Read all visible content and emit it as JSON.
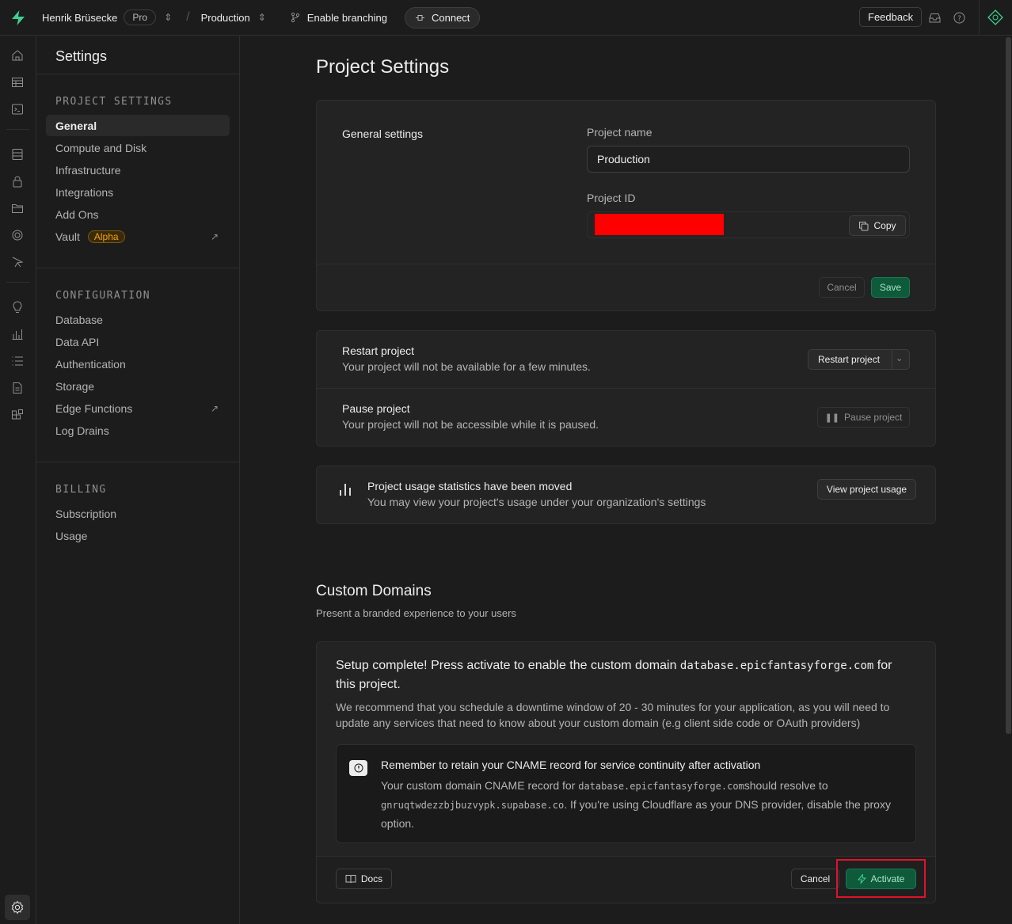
{
  "topbar": {
    "user": "Henrik Brüsecke",
    "plan": "Pro",
    "project": "Production",
    "branching": "Enable branching",
    "connect": "Connect",
    "feedback": "Feedback"
  },
  "menu": {
    "title": "Settings",
    "sections": [
      {
        "title": "PROJECT SETTINGS",
        "items": [
          "General",
          "Compute and Disk",
          "Infrastructure",
          "Integrations",
          "Add Ons",
          "Vault"
        ]
      },
      {
        "title": "CONFIGURATION",
        "items": [
          "Database",
          "Data API",
          "Authentication",
          "Storage",
          "Edge Functions",
          "Log Drains"
        ]
      },
      {
        "title": "BILLING",
        "items": [
          "Subscription",
          "Usage"
        ]
      }
    ],
    "vault_badge": "Alpha"
  },
  "page": {
    "title": "Project Settings",
    "general": {
      "heading": "General settings",
      "name_label": "Project name",
      "name_value": "Production",
      "id_label": "Project ID",
      "copy": "Copy",
      "cancel": "Cancel",
      "save": "Save"
    },
    "restart": {
      "title": "Restart project",
      "desc": "Your project will not be available for a few minutes.",
      "button": "Restart project"
    },
    "pause": {
      "title": "Pause project",
      "desc": "Your project will not be accessible while it is paused.",
      "button": "Pause project"
    },
    "usage": {
      "title": "Project usage statistics have been moved",
      "desc": "You may view your project's usage under your organization's settings",
      "button": "View project usage"
    },
    "domains": {
      "title": "Custom Domains",
      "subtitle": "Present a branded experience to your users",
      "setup_pre": "Setup complete! Press activate to enable the custom domain ",
      "domain": "database.epicfantasyforge.com",
      "setup_post": " for this project.",
      "recommend": "We recommend that you schedule a downtime window of 20 - 30 minutes for your application, as you will need to update any services that need to know about your custom domain (e.g client side code or OAuth providers)",
      "alert_title": "Remember to retain your CNAME record for service continuity after activation",
      "alert_pre": "Your custom domain CNAME record for ",
      "alert_mid": "should resolve to ",
      "alert_target": "gnruqtwdezzbjbuzvypk.supabase.co",
      "alert_post": ". If you're using Cloudflare as your DNS provider, disable the proxy option.",
      "docs": "Docs",
      "cancel": "Cancel",
      "activate": "Activate"
    }
  },
  "colors": {
    "accent": "#3ecf8e",
    "redacted": "#ff0000",
    "highlight": "#e0132a"
  }
}
